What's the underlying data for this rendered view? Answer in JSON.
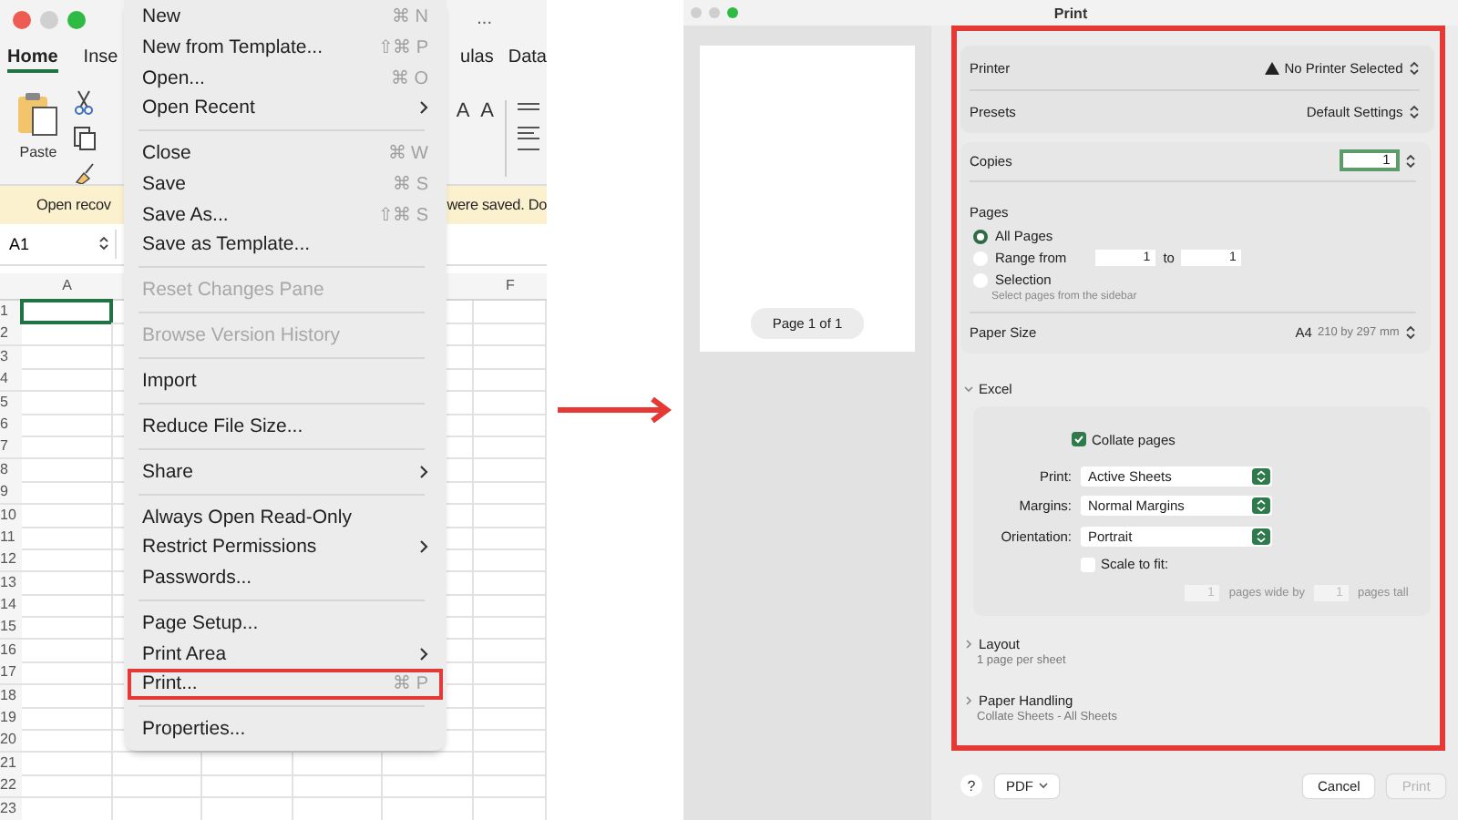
{
  "excel": {
    "window_more": "...",
    "ribbon_tabs": [
      {
        "label": "Home",
        "selected": true
      },
      {
        "label": "Inse",
        "selected": false
      },
      {
        "label": "ulas",
        "selected": false
      },
      {
        "label": "Data",
        "selected": false
      }
    ],
    "paste_label": "Paste",
    "font_size_buttons": [
      "A",
      "A"
    ],
    "notice": [
      "Open recov",
      "were saved. Do"
    ],
    "name_box": "A1",
    "column_headers": [
      "A",
      "F"
    ],
    "row_numbers": [
      "1",
      "2",
      "3",
      "4",
      "5",
      "6",
      "7",
      "8",
      "9",
      "10",
      "11",
      "12",
      "13",
      "14",
      "15",
      "16",
      "17",
      "18",
      "19",
      "20",
      "21",
      "22",
      "23"
    ]
  },
  "file_menu": {
    "items": [
      {
        "kind": "item",
        "label": "New",
        "shortcut": "⌘ N",
        "submenu": false,
        "disabled": false,
        "highlighted": false
      },
      {
        "kind": "item",
        "label": "New from Template...",
        "shortcut": "⇧⌘ P",
        "submenu": false,
        "disabled": false,
        "highlighted": false
      },
      {
        "kind": "item",
        "label": "Open...",
        "shortcut": "⌘ O",
        "submenu": false,
        "disabled": false,
        "highlighted": false
      },
      {
        "kind": "item",
        "label": "Open Recent",
        "submenu": true,
        "disabled": false,
        "highlighted": false
      },
      {
        "kind": "separator"
      },
      {
        "kind": "item",
        "label": "Close",
        "shortcut": "⌘ W",
        "submenu": false,
        "disabled": false,
        "highlighted": false
      },
      {
        "kind": "item",
        "label": "Save",
        "shortcut": "⌘ S",
        "submenu": false,
        "disabled": false,
        "highlighted": false
      },
      {
        "kind": "item",
        "label": "Save As...",
        "shortcut": "⇧⌘ S",
        "submenu": false,
        "disabled": false,
        "highlighted": false
      },
      {
        "kind": "item",
        "label": "Save as Template...",
        "submenu": false,
        "disabled": false,
        "highlighted": false
      },
      {
        "kind": "separator"
      },
      {
        "kind": "item",
        "label": "Reset Changes Pane",
        "submenu": false,
        "disabled": true,
        "highlighted": false
      },
      {
        "kind": "separator"
      },
      {
        "kind": "item",
        "label": "Browse Version History",
        "submenu": false,
        "disabled": true,
        "highlighted": false
      },
      {
        "kind": "separator"
      },
      {
        "kind": "item",
        "label": "Import",
        "submenu": false,
        "disabled": false,
        "highlighted": false
      },
      {
        "kind": "separator"
      },
      {
        "kind": "item",
        "label": "Reduce File Size...",
        "submenu": false,
        "disabled": false,
        "highlighted": false
      },
      {
        "kind": "separator"
      },
      {
        "kind": "item",
        "label": "Share",
        "submenu": true,
        "disabled": false,
        "highlighted": false
      },
      {
        "kind": "separator"
      },
      {
        "kind": "item",
        "label": "Always Open Read-Only",
        "submenu": false,
        "disabled": false,
        "highlighted": false
      },
      {
        "kind": "item",
        "label": "Restrict Permissions",
        "submenu": true,
        "disabled": false,
        "highlighted": false
      },
      {
        "kind": "item",
        "label": "Passwords...",
        "submenu": false,
        "disabled": false,
        "highlighted": false
      },
      {
        "kind": "separator"
      },
      {
        "kind": "item",
        "label": "Page Setup...",
        "submenu": false,
        "disabled": false,
        "highlighted": false
      },
      {
        "kind": "item",
        "label": "Print Area",
        "submenu": true,
        "disabled": false,
        "highlighted": false
      },
      {
        "kind": "item",
        "label": "Print...",
        "shortcut": "⌘ P",
        "submenu": false,
        "disabled": false,
        "highlighted": true
      },
      {
        "kind": "separator"
      },
      {
        "kind": "item",
        "label": "Properties...",
        "submenu": false,
        "disabled": false,
        "highlighted": false
      }
    ]
  },
  "print_dialog": {
    "title": "Print",
    "preview": {
      "page_label": "Page 1 of 1"
    },
    "printer": {
      "label": "Printer",
      "value": "No Printer Selected"
    },
    "presets": {
      "label": "Presets",
      "value": "Default Settings"
    },
    "copies": {
      "label": "Copies",
      "value": "1"
    },
    "pages": {
      "label": "Pages",
      "range_from": "1",
      "range_to_label": "to",
      "range_to": "1",
      "options": [
        {
          "label": "All Pages",
          "selected": true
        },
        {
          "label": "Range from",
          "selected": false
        },
        {
          "label": "Selection",
          "selected": false,
          "hint": "Select pages from the sidebar"
        }
      ]
    },
    "paper_size": {
      "label": "Paper Size",
      "value": "A4",
      "detail": "210 by 297 mm"
    },
    "excel": {
      "title": "Excel",
      "expanded": true,
      "collate": {
        "label": "Collate pages",
        "checked": true
      },
      "selects": [
        {
          "label": "Print:",
          "value": "Active Sheets"
        },
        {
          "label": "Margins:",
          "value": "Normal Margins"
        },
        {
          "label": "Orientation:",
          "value": "Portrait"
        }
      ],
      "scale_to_fit": {
        "label": "Scale to fit:",
        "checked": false,
        "wide": "1",
        "wide_label": "pages wide by",
        "tall": "1",
        "tall_label": "pages tall"
      }
    },
    "sections": [
      {
        "title": "Layout",
        "summary": "1 page per sheet",
        "expanded": false
      },
      {
        "title": "Paper Handling",
        "summary": "Collate Sheets - All Sheets",
        "expanded": false
      }
    ],
    "footer": {
      "help": "?",
      "pdf": "PDF",
      "cancel": "Cancel",
      "print": "Print",
      "print_disabled": true
    }
  }
}
